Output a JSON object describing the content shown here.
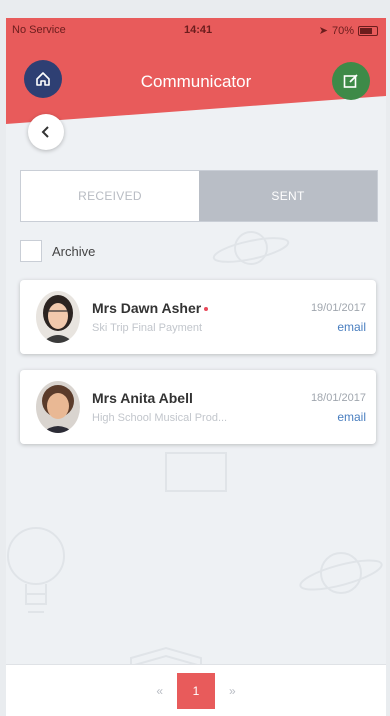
{
  "status_bar": {
    "carrier": "No Service",
    "time": "14:41",
    "battery": "70%"
  },
  "header": {
    "title": "Communicator"
  },
  "tabs": [
    {
      "label": "RECEIVED",
      "active": false
    },
    {
      "label": "SENT",
      "active": true
    }
  ],
  "archive": {
    "label": "Archive",
    "checked": false
  },
  "messages": [
    {
      "name": "Mrs Dawn Asher",
      "unread": true,
      "subject": "Ski Trip Final Payment",
      "date": "19/01/2017",
      "type": "email"
    },
    {
      "name": "Mrs Anita Abell",
      "unread": false,
      "subject": "High School Musical Prod...",
      "date": "18/01/2017",
      "type": "email"
    }
  ],
  "pagination": {
    "prev": "«",
    "current": "1",
    "next": "»"
  },
  "colors": {
    "header_red": "#e85b5b",
    "home_button": "#2e3f73",
    "compose_button": "#3e8a48",
    "link_blue": "#4a7fc0",
    "tab_active": "#b9bec6"
  },
  "icons": {
    "home": "home-icon",
    "compose": "compose-icon",
    "back": "chevron-left-icon"
  }
}
